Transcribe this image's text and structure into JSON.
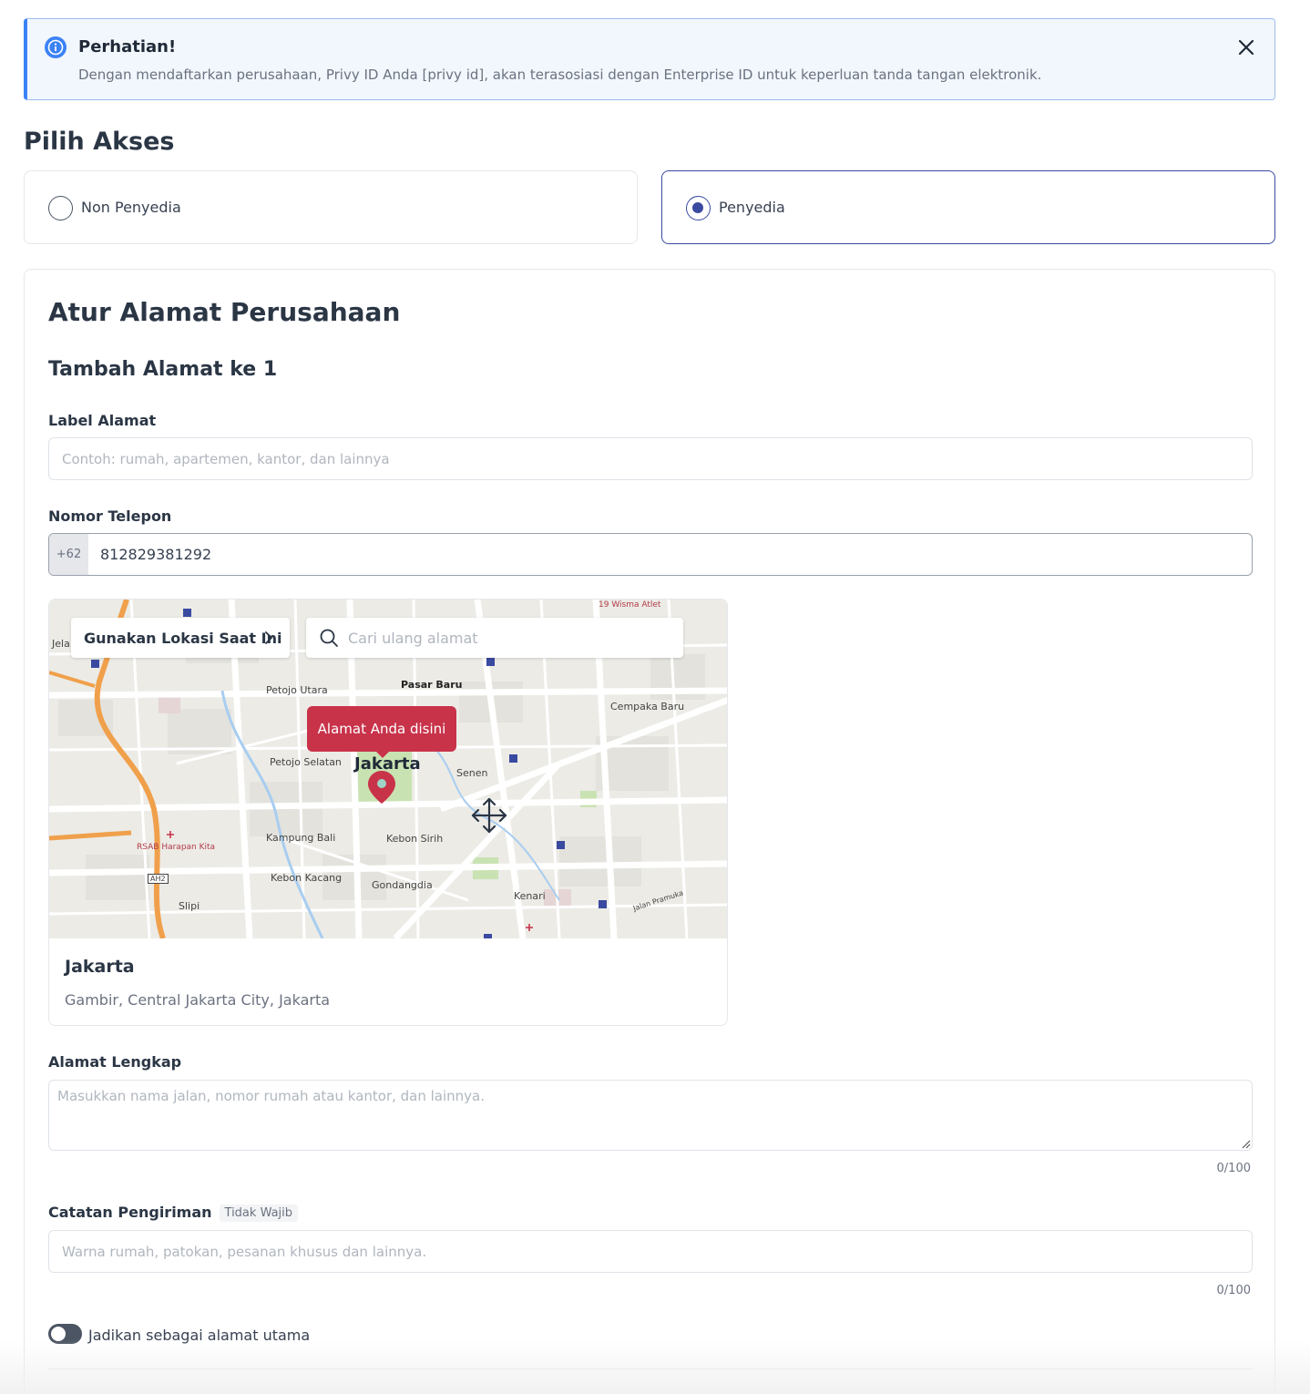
{
  "alert": {
    "title": "Perhatian!",
    "message": "Dengan mendaftarkan perusahaan, Privy ID Anda [privy id], akan terasosiasi dengan Enterprise ID untuk keperluan tanda tangan elektronik.",
    "icon": "info-icon",
    "close_icon": "close-icon",
    "accent_color": "#3b82f6"
  },
  "access": {
    "title": "Pilih Akses",
    "options": [
      {
        "label": "Non Penyedia",
        "selected": false
      },
      {
        "label": "Penyedia",
        "selected": true
      }
    ],
    "selected_color": "#3a4aa0"
  },
  "address": {
    "title": "Atur Alamat Perusahaan",
    "subtitle": "Tambah Alamat ke 1",
    "label_field": {
      "label": "Label Alamat",
      "placeholder": "Contoh: rumah, apartemen, kantor, dan lainnya",
      "value": ""
    },
    "phone_field": {
      "label": "Nomor Telepon",
      "prefix": "+62",
      "value": "812829381292"
    },
    "map": {
      "use_location_label": "Gunakan Lokasi Saat Ini",
      "search_placeholder": "Cari ulang alamat",
      "pin_tooltip": "Alamat Anda disini",
      "pin_color": "#c8334a",
      "labels": {
        "jela": "Jela",
        "petojo_utara": "Petojo Utara",
        "pasar_baru": "Pasar Baru",
        "cempaka_baru": "Cempaka Baru",
        "petojo_selatan": "Petojo Selatan",
        "jakarta": "Jakarta",
        "senen": "Senen",
        "kampung_bali": "Kampung Bali",
        "kebon_sirih": "Kebon Sirih",
        "rsab": "RSAB Harapan Kita",
        "kebon_kacang": "Kebon Kacang",
        "gondangdia": "Gondangdia",
        "kenari": "Kenari",
        "slipi": "Slipi",
        "wisma_atlet": "19 Wisma Atlet",
        "jalan_pramuka": "Jalan Pramuka",
        "ah2": "AH2"
      },
      "location_name": "Jakarta",
      "location_address": "Gambir, Central Jakarta City, Jakarta"
    },
    "full_address_field": {
      "label": "Alamat Lengkap",
      "placeholder": "Masukkan nama jalan, nomor rumah atau kantor, dan lainnya.",
      "value": "",
      "counter": "0/100"
    },
    "delivery_note_field": {
      "label": "Catatan Pengiriman",
      "optional_badge": "Tidak Wajib",
      "placeholder": "Warna rumah, patokan, pesanan khusus dan lainnya.",
      "value": "",
      "counter": "0/100"
    },
    "primary_toggle": {
      "label": "Jadikan sebagai alamat utama",
      "on": false
    }
  }
}
